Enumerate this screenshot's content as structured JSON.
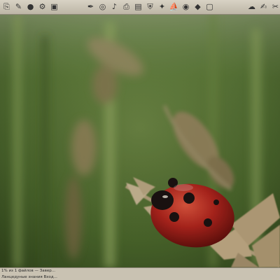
{
  "top_toolbar": {
    "left_icons": [
      {
        "name": "folder-open-icon",
        "glyph": "⎘"
      },
      {
        "name": "bookmark-icon",
        "glyph": "✎"
      },
      {
        "name": "red-ball-icon",
        "glyph": "●"
      },
      {
        "name": "gear-icon",
        "glyph": "⚙"
      },
      {
        "name": "picture-icon",
        "glyph": "▣"
      }
    ],
    "middle_icons": [
      {
        "name": "pen-icon",
        "glyph": "✒"
      },
      {
        "name": "globe-icon",
        "glyph": "◎"
      },
      {
        "name": "bell-icon",
        "glyph": "♪"
      },
      {
        "name": "printer-icon",
        "glyph": "⎙"
      },
      {
        "name": "image-icon",
        "glyph": "▤"
      },
      {
        "name": "shield-icon",
        "glyph": "⛨"
      },
      {
        "name": "butterfly-icon",
        "glyph": "✦"
      },
      {
        "name": "ship-icon",
        "glyph": "⛵"
      },
      {
        "name": "globe-2-icon",
        "glyph": "◉"
      },
      {
        "name": "drop-icon",
        "glyph": "◆"
      },
      {
        "name": "window-icon",
        "glyph": "▢"
      }
    ],
    "right_icons": [
      {
        "name": "chat-icon",
        "glyph": "☁"
      },
      {
        "name": "edit-icon",
        "glyph": "✍"
      },
      {
        "name": "tools-icon",
        "glyph": "✂"
      }
    ]
  },
  "status_bar": {
    "line1": "1% из 1 файлов — Завер...",
    "line2": "Ланцедуные знания Вход..."
  },
  "colors": {
    "toolbar_bg": "#cfc8b8",
    "background_green": "#3f5a25",
    "ladybug_red": "#b0251d"
  }
}
